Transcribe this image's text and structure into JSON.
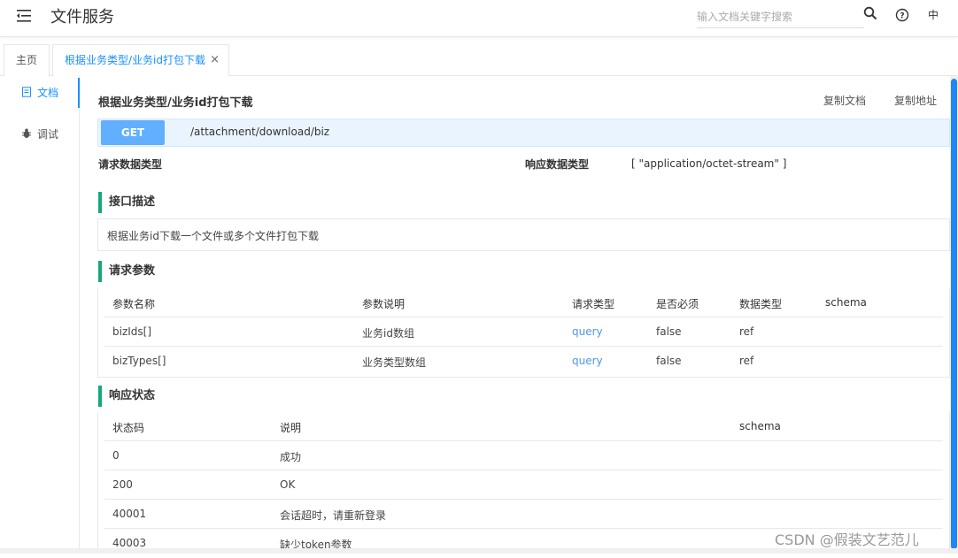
{
  "header": {
    "title": "文件服务",
    "search_placeholder": "输入文档关键字搜索",
    "lang": "中"
  },
  "tabs": [
    {
      "label": "主页"
    },
    {
      "label": "根据业务类型/业务id打包下载",
      "close": "×"
    }
  ],
  "sidebar": {
    "items": [
      {
        "label": "文档"
      },
      {
        "label": "调试"
      }
    ]
  },
  "api": {
    "title": "根据业务类型/业务id打包下载",
    "copy_doc": "复制文档",
    "copy_addr": "复制地址",
    "method": "GET",
    "path": "/attachment/download/biz",
    "request_type_label": "请求数据类型",
    "response_type_label": "响应数据类型",
    "response_type_value": "[ \"application/octet-stream\" ]"
  },
  "description": {
    "heading": "接口描述",
    "text": "根据业务id下载一个文件或多个文件打包下载"
  },
  "params": {
    "heading": "请求参数",
    "columns": [
      "参数名称",
      "参数说明",
      "请求类型",
      "是否必须",
      "数据类型",
      "schema"
    ],
    "rows": [
      [
        "bizIds[]",
        "业务id数组",
        "query",
        "false",
        "ref",
        ""
      ],
      [
        "bizTypes[]",
        "业务类型数组",
        "query",
        "false",
        "ref",
        ""
      ]
    ]
  },
  "responses": {
    "heading": "响应状态",
    "columns": [
      "状态码",
      "说明",
      "schema"
    ],
    "rows": [
      [
        "0",
        "成功",
        ""
      ],
      [
        "200",
        "OK",
        ""
      ],
      [
        "40001",
        "会话超时，请重新登录",
        ""
      ],
      [
        "40003",
        "缺少token参数",
        ""
      ]
    ]
  },
  "watermark": "CSDN @假装文艺范儿",
  "colors": {
    "accent": "#1890ff",
    "get_method": "#61affe",
    "section_bar": "#17a77d",
    "query_text": "#4f96e8"
  }
}
